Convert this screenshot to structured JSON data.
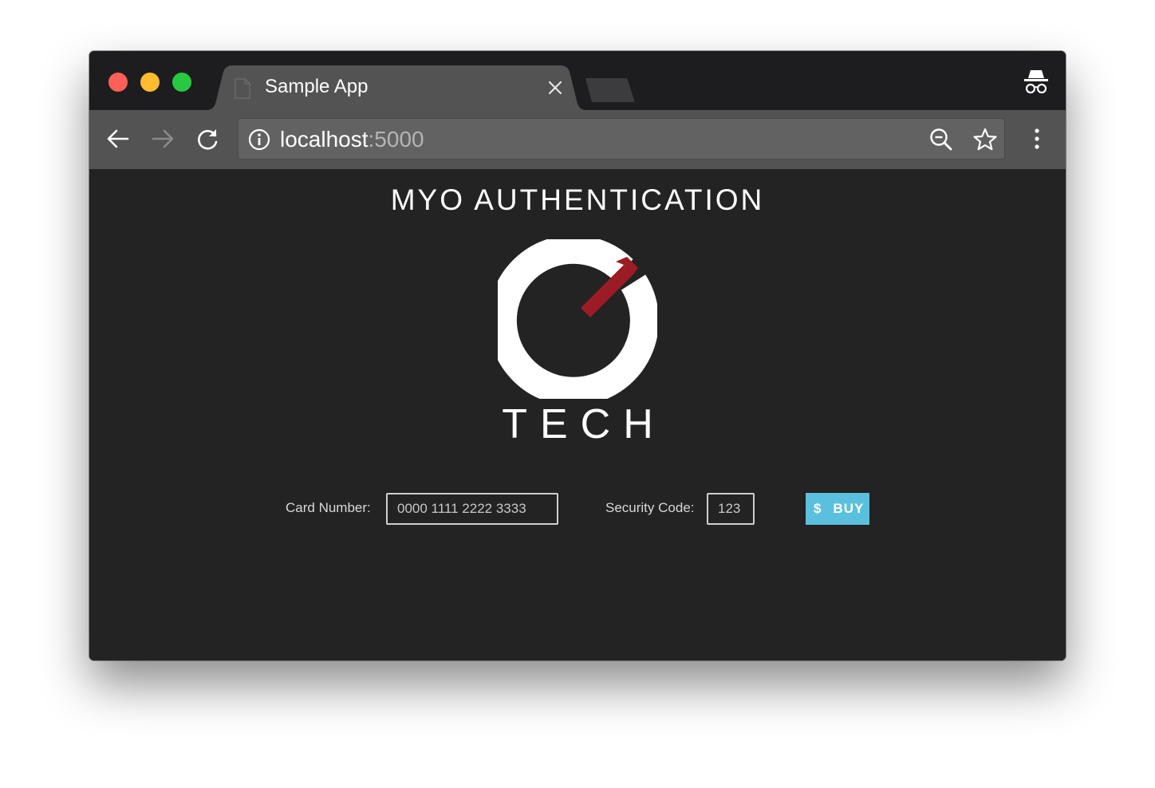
{
  "browser": {
    "tab_title": "Sample App",
    "url_host": "localhost",
    "url_port": ":5000"
  },
  "page": {
    "heading": "MYO AUTHENTICATION",
    "logo_text": "TECH",
    "logo_colors": {
      "ring": "#ffffff",
      "accent": "#9b1c24"
    }
  },
  "form": {
    "card_label": "Card Number:",
    "card_placeholder": "0000 1111 2222 3333",
    "security_label": "Security Code:",
    "security_placeholder": "123",
    "buy_icon": "$",
    "buy_label": "BUY"
  },
  "colors": {
    "accent": "#5bc0de",
    "background": "#232323",
    "toolbar": "#535353",
    "titlebar": "#1d1d1f"
  }
}
